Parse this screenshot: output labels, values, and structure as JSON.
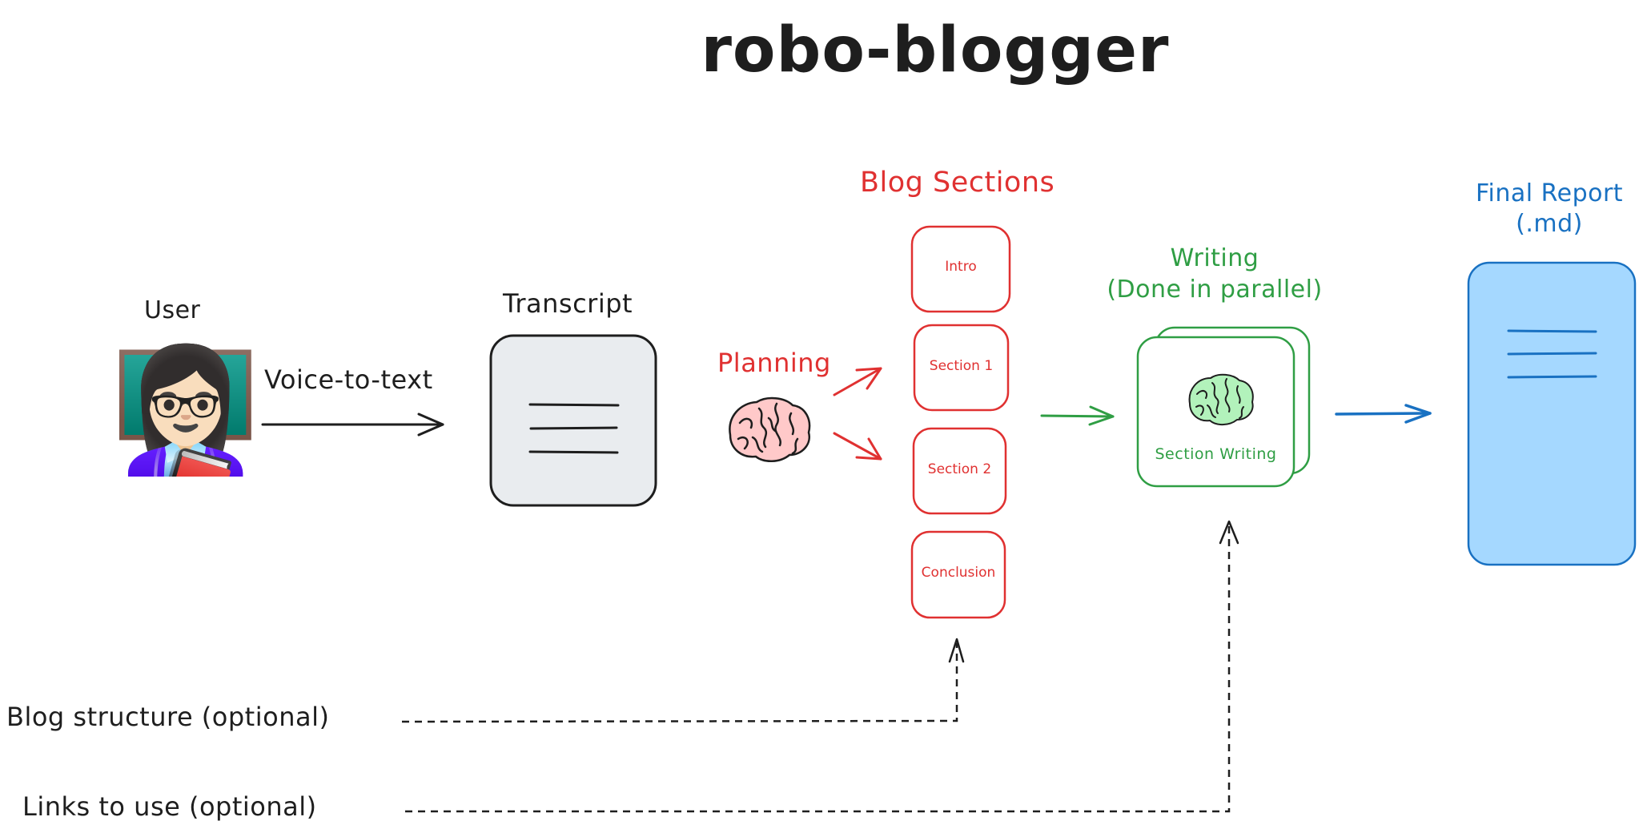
{
  "title": "robo-blogger",
  "nodes": {
    "user": {
      "label": "User",
      "icon": "teacher-emoji",
      "glyph": "👩🏻‍🏫"
    },
    "voice_to_text": {
      "label": "Voice-to-text"
    },
    "transcript": {
      "label": "Transcript",
      "icon": "document-lines-icon"
    },
    "planning": {
      "label": "Planning",
      "icon": "brain-icon"
    },
    "blog_sections": {
      "label": "Blog Sections",
      "sections": [
        "Intro",
        "Section 1",
        "Section 2",
        "Conclusion"
      ]
    },
    "writing": {
      "label_line1": "Writing",
      "label_line2": "(Done in parallel)",
      "card_label": "Section Writing",
      "icon": "brain-icon"
    },
    "final_report": {
      "label_line1": "Final Report",
      "label_line2": "(.md)",
      "icon": "document-lines-icon"
    }
  },
  "optional_inputs": [
    {
      "label": "Blog structure (optional)",
      "target": "Blog Sections"
    },
    {
      "label": "Links to use (optional)",
      "target": "Section Writing"
    }
  ],
  "colors": {
    "ink": "#1e1e1e",
    "planning_red": "#e03131",
    "writing_green": "#2f9e44",
    "report_blue": "#1971c2",
    "report_fill": "#a5d8ff",
    "transcript_fill": "#e9ecef",
    "brain_pink": "#ffc9c9",
    "brain_green": "#b2f2bb"
  }
}
